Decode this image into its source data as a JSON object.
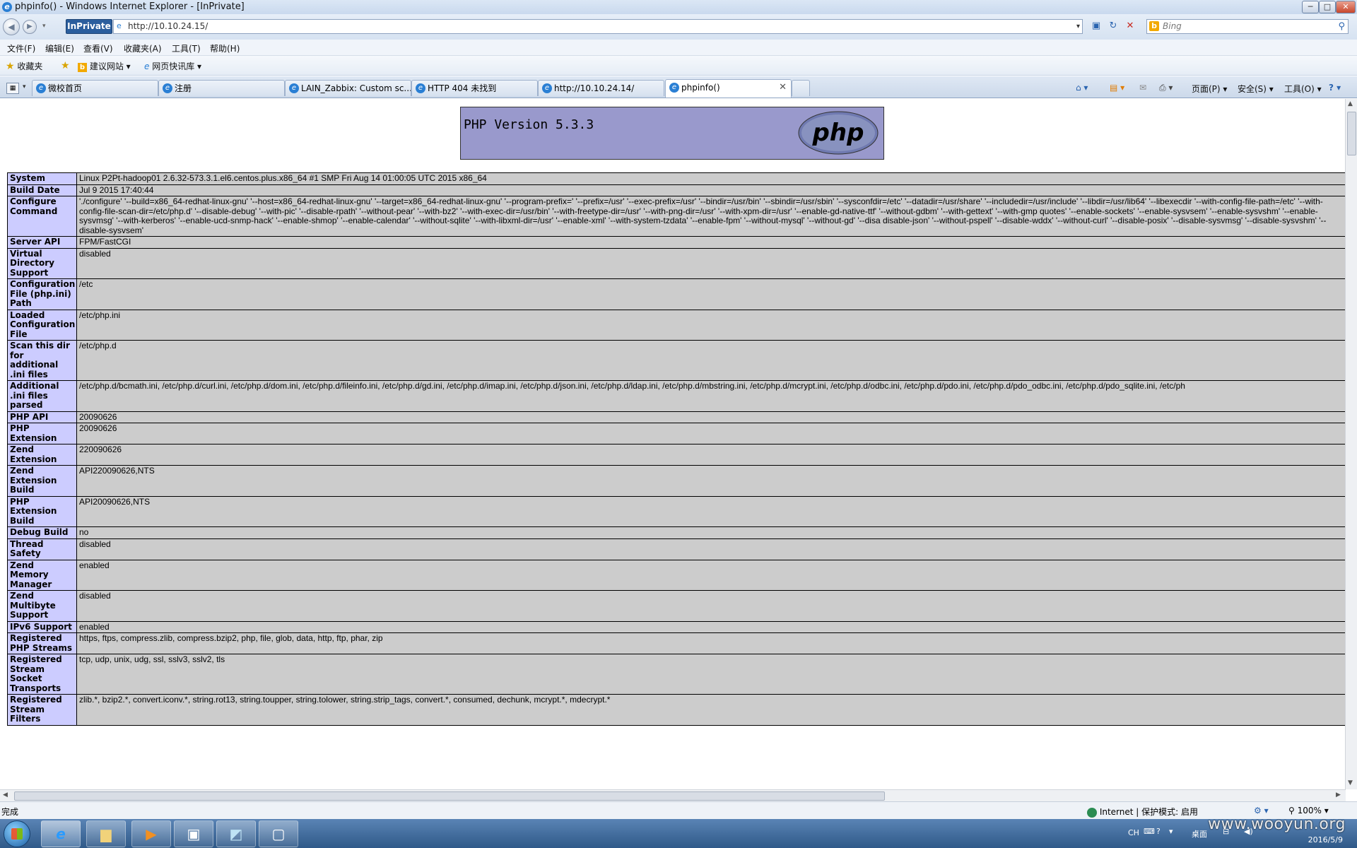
{
  "window": {
    "title": "phpinfo() - Windows Internet Explorer - [InPrivate]",
    "controls": {
      "minimize": "─",
      "maximize": "□",
      "close": "✕"
    }
  },
  "address_bar": {
    "inprivate_label": "InPrivate",
    "url": "http://10.10.24.15/",
    "search_placeholder": "Bing"
  },
  "menu": [
    "文件(F)",
    "编辑(E)",
    "查看(V)",
    "收藏夹(A)",
    "工具(T)",
    "帮助(H)"
  ],
  "favorites_bar": {
    "favorites_label": "收藏夹",
    "items": [
      "建议网站 ▾",
      "网页快讯库 ▾"
    ]
  },
  "tabs": [
    {
      "label": "微校首页"
    },
    {
      "label": "注册"
    },
    {
      "label": "LAIN_Zabbix: Custom sc..."
    },
    {
      "label": "HTTP 404 未找到"
    },
    {
      "label": "http://10.10.24.14/"
    },
    {
      "label": "phpinfo()",
      "active": true
    }
  ],
  "command_bar": {
    "page": "页面(P) ▾",
    "safety": "安全(S) ▾",
    "tools": "工具(O) ▾",
    "help": "? ▾"
  },
  "php": {
    "version_title": "PHP Version 5.3.3",
    "logo_text": "php",
    "rows": [
      {
        "key": "System",
        "value": "Linux P2Pt-hadoop01 2.6.32-573.3.1.el6.centos.plus.x86_64 #1 SMP Fri Aug 14 01:00:05 UTC 2015 x86_64"
      },
      {
        "key": "Build Date",
        "value": "Jul 9 2015 17:40:44"
      },
      {
        "key": "Configure Command",
        "value": "'./configure' '--build=x86_64-redhat-linux-gnu' '--host=x86_64-redhat-linux-gnu' '--target=x86_64-redhat-linux-gnu' '--program-prefix=' '--prefix=/usr' '--exec-prefix=/usr' '--bindir=/usr/bin' '--sbindir=/usr/sbin' '--sysconfdir=/etc' '--datadir=/usr/share' '--includedir=/usr/include' '--libdir=/usr/lib64' '--libexecdir '--with-config-file-path=/etc' '--with-config-file-scan-dir=/etc/php.d' '--disable-debug' '--with-pic' '--disable-rpath' '--without-pear' '--with-bz2' '--with-exec-dir=/usr/bin' '--with-freetype-dir=/usr' '--with-png-dir=/usr' '--with-xpm-dir=/usr' '--enable-gd-native-ttf' '--without-gdbm' '--with-gettext' '--with-gmp quotes' '--enable-sockets' '--enable-sysvsem' '--enable-sysvshm' '--enable-sysvmsg' '--with-kerberos' '--enable-ucd-snmp-hack' '--enable-shmop' '--enable-calendar' '--without-sqlite' '--with-libxml-dir=/usr' '--enable-xml' '--with-system-tzdata' '--enable-fpm' '--without-mysql' '--without-gd' '--disa disable-json' '--without-pspell' '--disable-wddx' '--without-curl' '--disable-posix' '--disable-sysvmsg' '--disable-sysvshm' '--disable-sysvsem'"
      },
      {
        "key": "Server API",
        "value": "FPM/FastCGI"
      },
      {
        "key": "Virtual Directory Support",
        "value": "disabled"
      },
      {
        "key": "Configuration File (php.ini) Path",
        "value": "/etc"
      },
      {
        "key": "Loaded Configuration File",
        "value": "/etc/php.ini"
      },
      {
        "key": "Scan this dir for additional .ini files",
        "value": "/etc/php.d"
      },
      {
        "key": "Additional .ini files parsed",
        "value": "/etc/php.d/bcmath.ini, /etc/php.d/curl.ini, /etc/php.d/dom.ini, /etc/php.d/fileinfo.ini, /etc/php.d/gd.ini, /etc/php.d/imap.ini, /etc/php.d/json.ini, /etc/php.d/ldap.ini, /etc/php.d/mbstring.ini, /etc/php.d/mcrypt.ini, /etc/php.d/odbc.ini, /etc/php.d/pdo.ini, /etc/php.d/pdo_odbc.ini, /etc/php.d/pdo_sqlite.ini, /etc/ph"
      },
      {
        "key": "PHP API",
        "value": "20090626"
      },
      {
        "key": "PHP Extension",
        "value": "20090626"
      },
      {
        "key": "Zend Extension",
        "value": "220090626"
      },
      {
        "key": "Zend Extension Build",
        "value": "API220090626,NTS"
      },
      {
        "key": "PHP Extension Build",
        "value": "API20090626,NTS"
      },
      {
        "key": "Debug Build",
        "value": "no"
      },
      {
        "key": "Thread Safety",
        "value": "disabled"
      },
      {
        "key": "Zend Memory Manager",
        "value": "enabled"
      },
      {
        "key": "Zend Multibyte Support",
        "value": "disabled"
      },
      {
        "key": "IPv6 Support",
        "value": "enabled"
      },
      {
        "key": "Registered PHP Streams",
        "value": "https, ftps, compress.zlib, compress.bzip2, php, file, glob, data, http, ftp, phar, zip"
      },
      {
        "key": "Registered Stream Socket Transports",
        "value": "tcp, udp, unix, udg, ssl, sslv3, sslv2, tls"
      },
      {
        "key": "Registered Stream Filters",
        "value": "zlib.*, bzip2.*, convert.iconv.*, string.rot13, string.toupper, string.tolower, string.strip_tags, convert.*, consumed, dechunk, mcrypt.*, mdecrypt.*"
      }
    ]
  },
  "status_bar": {
    "status": "完成",
    "zone": "Internet | 保护模式: 启用",
    "zoom": "100%"
  },
  "taskbar": {
    "tray_lang": "CH",
    "tray_desktop": "桌面",
    "date": "2016/5/9",
    "watermark": "www.wooyun.org"
  }
}
